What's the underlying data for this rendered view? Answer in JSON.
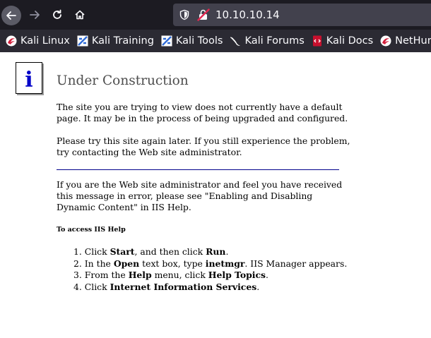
{
  "browser": {
    "url": "10.10.10.14",
    "bookmarks": [
      {
        "label": "Kali Linux",
        "icon": "kali-dragon-red-icon"
      },
      {
        "label": "Kali Training",
        "icon": "kali-training-icon"
      },
      {
        "label": "Kali Tools",
        "icon": "kali-tools-icon"
      },
      {
        "label": "Kali Forums",
        "icon": "kali-dragon-white-icon"
      },
      {
        "label": "Kali Docs",
        "icon": "kali-docs-icon"
      },
      {
        "label": "NetHunter",
        "icon": "nethunter-icon"
      }
    ],
    "colors": {
      "toolbar": "#1c1b22",
      "urlbar": "#42414d",
      "bookmarks_bar": "#2b2a33"
    }
  },
  "page": {
    "icon_letter": "i",
    "title": "Under Construction",
    "para1": "The site you are trying to view does not currently have a default page. It may be in the process of being upgraded and configured.",
    "para2": "Please try this site again later. If you still experience the problem, try contacting the Web site administrator.",
    "para3": "If you are the Web site administrator and feel you have received this message in error, please see \"Enabling and Disabling Dynamic Content\" in IIS Help.",
    "subheading": "To access IIS Help",
    "steps": {
      "s1": {
        "num": "1.",
        "a": "Click ",
        "b": "Start",
        "c": ", and then click ",
        "d": "Run",
        "e": "."
      },
      "s2": {
        "num": "2.",
        "a": "In the ",
        "b": "Open",
        "c": " text box, type ",
        "d": "inetmgr",
        "e": ". IIS Manager appears."
      },
      "s3": {
        "num": "3.",
        "a": "From the ",
        "b": "Help",
        "c": " menu, click ",
        "d": "Help Topics",
        "e": "."
      },
      "s4": {
        "num": "4.",
        "a": "Click ",
        "b": "Internet Information Services",
        "e": "."
      }
    }
  }
}
